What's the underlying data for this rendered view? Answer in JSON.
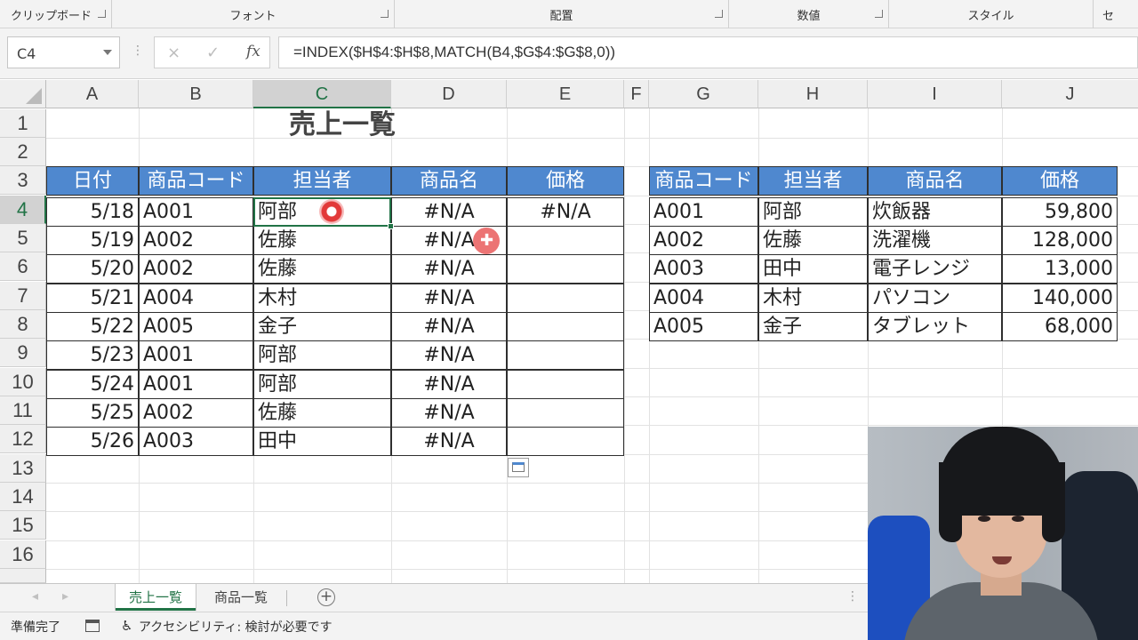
{
  "ribbon": {
    "groups": [
      "クリップボード",
      "フォント",
      "配置",
      "数値",
      "スタイル",
      "セ"
    ]
  },
  "formula_bar": {
    "name_box": "C4",
    "cancel_icon": "×",
    "enter_icon": "✓",
    "fx_label": "fx",
    "formula": "=INDEX($H$4:$H$8,MATCH(B4,$G$4:$G$8,0))"
  },
  "columns": [
    "A",
    "B",
    "C",
    "D",
    "E",
    "F",
    "G",
    "H",
    "I",
    "J"
  ],
  "rows": [
    "1",
    "2",
    "3",
    "4",
    "5",
    "6",
    "7",
    "8",
    "9",
    "10",
    "11",
    "12",
    "13",
    "14",
    "15",
    "16"
  ],
  "sheet": {
    "title": "売上一覧",
    "sales_headers": [
      "日付",
      "商品コード",
      "担当者",
      "商品名",
      "価格"
    ],
    "sales_rows": [
      {
        "date": "5/18",
        "code": "A001",
        "person": "阿部",
        "product": "#N/A",
        "price": "#N/A"
      },
      {
        "date": "5/19",
        "code": "A002",
        "person": "佐藤",
        "product": "#N/A",
        "price": ""
      },
      {
        "date": "5/20",
        "code": "A002",
        "person": "佐藤",
        "product": "#N/A",
        "price": ""
      },
      {
        "date": "5/21",
        "code": "A004",
        "person": "木村",
        "product": "#N/A",
        "price": ""
      },
      {
        "date": "5/22",
        "code": "A005",
        "person": "金子",
        "product": "#N/A",
        "price": ""
      },
      {
        "date": "5/23",
        "code": "A001",
        "person": "阿部",
        "product": "#N/A",
        "price": ""
      },
      {
        "date": "5/24",
        "code": "A001",
        "person": "阿部",
        "product": "#N/A",
        "price": ""
      },
      {
        "date": "5/25",
        "code": "A002",
        "person": "佐藤",
        "product": "#N/A",
        "price": ""
      },
      {
        "date": "5/26",
        "code": "A003",
        "person": "田中",
        "product": "#N/A",
        "price": ""
      }
    ],
    "master_headers": [
      "商品コード",
      "担当者",
      "商品名",
      "価格"
    ],
    "master_rows": [
      {
        "code": "A001",
        "person": "阿部",
        "product": "炊飯器",
        "price": "59,800"
      },
      {
        "code": "A002",
        "person": "佐藤",
        "product": "洗濯機",
        "price": "128,000"
      },
      {
        "code": "A003",
        "person": "田中",
        "product": "電子レンジ",
        "price": "13,000"
      },
      {
        "code": "A004",
        "person": "木村",
        "product": "パソコン",
        "price": "140,000"
      },
      {
        "code": "A005",
        "person": "金子",
        "product": "タブレット",
        "price": "68,000"
      }
    ]
  },
  "tabs": {
    "sheets": [
      "売上一覧",
      "商品一覧"
    ],
    "active": "売上一覧",
    "add_icon": "+"
  },
  "status_bar": {
    "ready": "準備完了",
    "accessibility": "アクセシビリティ: 検討が必要です"
  },
  "colors": {
    "header_fill": "#4f88cf",
    "excel_green": "#217346"
  }
}
